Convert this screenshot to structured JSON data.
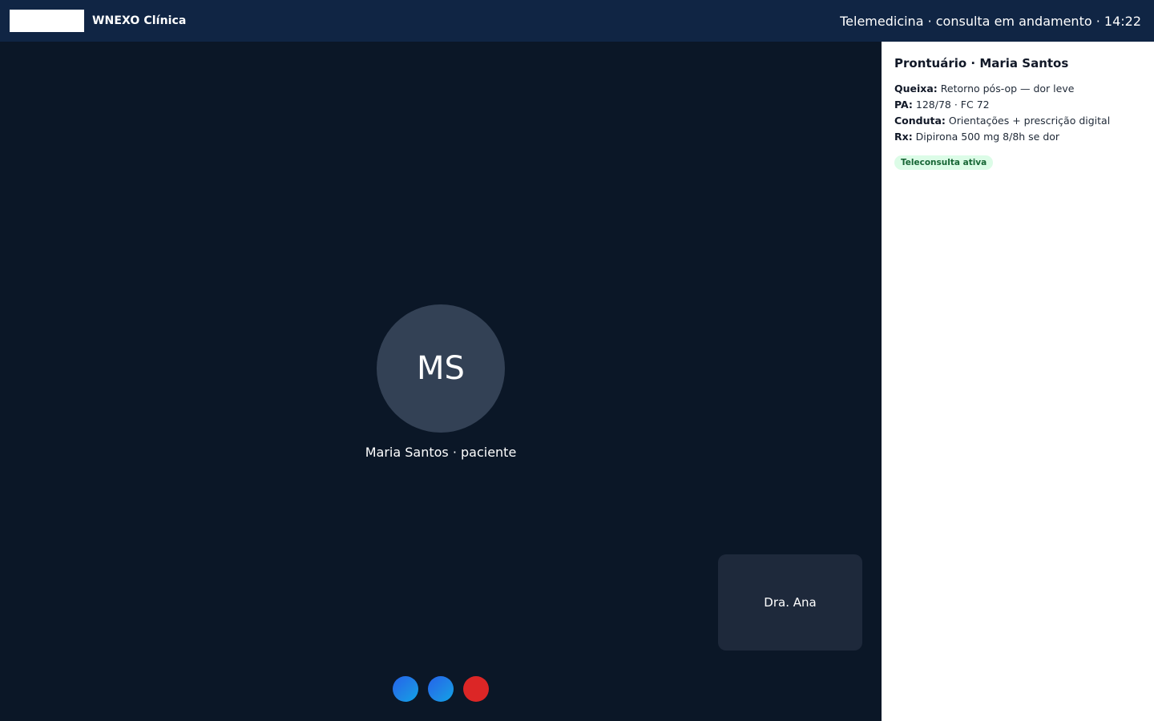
{
  "header": {
    "brand_name": "WNEXO Clínica",
    "call_status": "Telemedicina · consulta em andamento · 14:22"
  },
  "video": {
    "patient_initials": "MS",
    "patient_label": "Maria Santos · paciente",
    "self_view_label": "Dra. Ana",
    "controls": [
      {
        "icon": "microphone-icon",
        "color": "#1e88e5"
      },
      {
        "icon": "camera-icon",
        "color": "#1e88e5"
      },
      {
        "icon": "hang-up-icon",
        "color": "#dc2626"
      }
    ]
  },
  "panel": {
    "title": "Prontuário · Maria Santos",
    "items": [
      {
        "label": "Queixa:",
        "value": "Retorno pós-op — dor leve"
      },
      {
        "label": "PA:",
        "value": "128/78 · FC 72"
      },
      {
        "label": "Conduta:",
        "value": "Orientações + prescrição digital"
      },
      {
        "label": "Rx:",
        "value": "Dipirona 500 mg 8/8h se dor"
      }
    ],
    "status_badge": "Teleconsulta ativa"
  },
  "colors": {
    "header_bg": "#102544",
    "video_bg": "#0b1727",
    "avatar_bg": "#334155",
    "self_view_bg": "#1e293b",
    "end_call": "#dc2626",
    "badge_bg": "#dcfce7",
    "badge_text": "#166534"
  }
}
